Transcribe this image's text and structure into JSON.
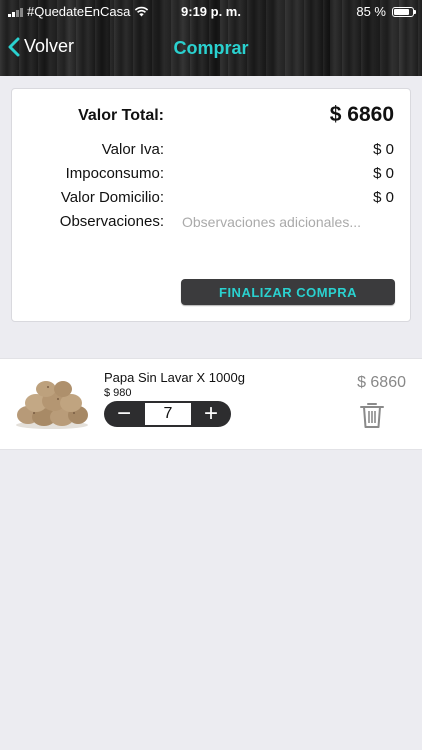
{
  "status_bar": {
    "carrier": "#QuedateEnCasa",
    "time": "9:19 p. m.",
    "battery": "85 %",
    "battery_level": 0.85
  },
  "nav": {
    "back_label": "Volver",
    "title": "Comprar"
  },
  "summary": {
    "total_label": "Valor Total:",
    "total_value": "$ 6860",
    "iva_label": "Valor Iva:",
    "iva_value": "$ 0",
    "impoconsumo_label": "Impoconsumo:",
    "impoconsumo_value": "$ 0",
    "domicilio_label": "Valor Domicilio:",
    "domicilio_value": "$ 0",
    "observaciones_label": "Observaciones:",
    "observaciones_placeholder": "Observaciones adicionales...",
    "observaciones_value": "",
    "finalize_label": "FINALIZAR COMPRA"
  },
  "cart": {
    "items": [
      {
        "name": "Papa Sin Lavar X 1000g",
        "unit_price": "$ 980",
        "quantity": "7",
        "minus_label": "−",
        "plus_label": "+",
        "line_total": "$ 6860"
      }
    ]
  },
  "colors": {
    "accent": "#2ad1cf",
    "button_dark": "#3b3b3d",
    "background": "#ececf1"
  },
  "icons": [
    "signal-icon",
    "wifi-icon",
    "battery-icon",
    "chevron-left-icon",
    "potato-image",
    "trash-icon"
  ]
}
